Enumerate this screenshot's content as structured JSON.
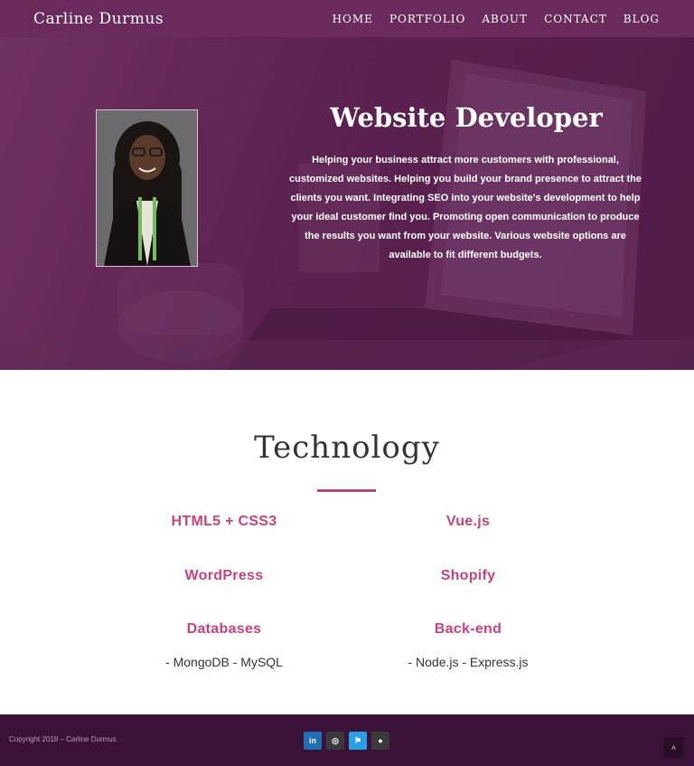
{
  "nav": {
    "brand": "Carline Durmus",
    "items": [
      "HOME",
      "PORTFOLIO",
      "ABOUT",
      "CONTACT",
      "BLOG"
    ]
  },
  "hero": {
    "title": "Website Developer",
    "text": "Helping your business attract more customers with professional, customized websites. Helping you build your brand presence to attract the clients you want. Integrating SEO into your website's development to help your ideal customer find you. Promoting open communication to produce the results you want from your website. Various website options are available to fit different budgets."
  },
  "technology": {
    "title": "Technology",
    "items": [
      {
        "label": "HTML5 + CSS3",
        "sub": ""
      },
      {
        "label": "Vue.js",
        "sub": ""
      },
      {
        "label": "WordPress",
        "sub": ""
      },
      {
        "label": "Shopify",
        "sub": ""
      },
      {
        "label": "Databases",
        "sub": "- MongoDB - MySQL"
      },
      {
        "label": "Back-end",
        "sub": "- Node.js - Express.js"
      }
    ]
  },
  "footer": {
    "copyright": "Copyright 2018 – Carline Durmus",
    "socials": [
      {
        "name": "linkedin-icon",
        "glyph": "in"
      },
      {
        "name": "instagram-icon",
        "glyph": "◎"
      },
      {
        "name": "twitter-icon",
        "glyph": "⚑"
      },
      {
        "name": "github-icon",
        "glyph": "●"
      }
    ],
    "to_top_glyph": "˄"
  },
  "colors": {
    "nav": "#6a2a5c",
    "accent": "#c9427e",
    "footer": "#3b1237"
  }
}
